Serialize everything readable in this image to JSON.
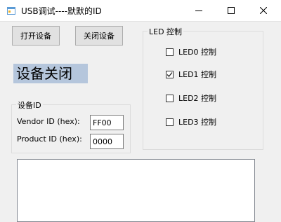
{
  "window": {
    "title": "USB调试----默默的ID",
    "controls": {
      "minimize": "minimize-icon",
      "maximize": "maximize-icon",
      "close": "close-icon"
    }
  },
  "toolbar": {
    "open_label": "打开设备",
    "close_label": "关闭设备"
  },
  "status": {
    "text": "设备关闭",
    "highlight_color": "#b5c6dc"
  },
  "led_group": {
    "title": "LED 控制",
    "items": [
      {
        "label": "LED0 控制",
        "checked": false
      },
      {
        "label": "LED1 控制",
        "checked": true
      },
      {
        "label": "LED2 控制",
        "checked": false
      },
      {
        "label": "LED3 控制",
        "checked": false
      }
    ]
  },
  "device_group": {
    "title": "设备ID",
    "vendor_label": "Vendor ID (hex):",
    "vendor_value": "FF00",
    "product_label": "Product ID (hex):",
    "product_value": "0000"
  },
  "output": {
    "text": ""
  }
}
